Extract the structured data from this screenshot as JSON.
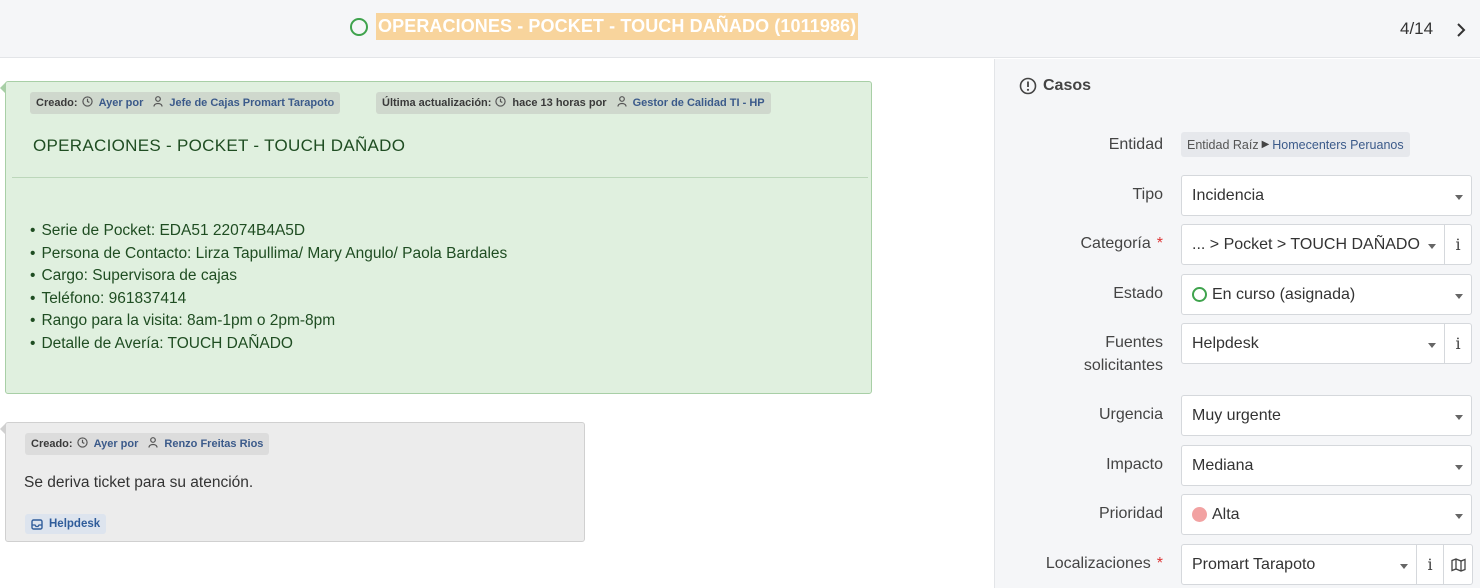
{
  "header": {
    "title": "OPERACIONES - POCKET - TOUCH DAÑADO (1011986)",
    "pager": "4/14"
  },
  "main_card": {
    "created_label": "Creado:",
    "created_when": "Ayer por",
    "created_by": "Jefe de Cajas Promart Tarapoto",
    "updated_label": "Última actualización:",
    "updated_when": "hace 13 horas por",
    "updated_by": "Gestor de Calidad TI - HP",
    "title": "OPERACIONES - POCKET - TOUCH DAÑADO",
    "details": [
      "Serie de Pocket: EDA51 22074B4A5D",
      "Persona de Contacto: Lirza Tapullima/ Mary Angulo/ Paola Bardales",
      "Cargo: Supervisora de cajas",
      "Teléfono: 961837414",
      "Rango para la visita: 8am-1pm o 2pm-8pm",
      "Detalle de Avería: TOUCH DAÑADO"
    ]
  },
  "followup": {
    "created_label": "Creado:",
    "created_when": "Ayer por",
    "created_by": "Renzo Freitas Rios",
    "text": "Se deriva ticket para su atención.",
    "source": "Helpdesk"
  },
  "panel": {
    "heading": "Casos",
    "entity": {
      "label": "Entidad",
      "root": "Entidad Raíz",
      "child": "Homecenters Peruanos"
    },
    "tipo": {
      "label": "Tipo",
      "value": "Incidencia"
    },
    "categoria": {
      "label": "Categoría",
      "value": "... > Pocket > TOUCH DAÑADO",
      "required": "*"
    },
    "estado": {
      "label": "Estado",
      "value": "En curso (asignada)"
    },
    "fuentes": {
      "label_1": "Fuentes",
      "label_2": "solicitantes",
      "value": "Helpdesk"
    },
    "urgencia": {
      "label": "Urgencia",
      "value": "Muy urgente"
    },
    "impacto": {
      "label": "Impacto",
      "value": "Mediana"
    },
    "prioridad": {
      "label": "Prioridad",
      "value": "Alta"
    },
    "localizaciones": {
      "label": "Localizaciones",
      "value": "Promart Tarapoto",
      "required": "*"
    },
    "info_glyph": "i"
  },
  "colors": {
    "status_green": "#3fa34d",
    "title_highlight": "#f8d49c",
    "card_green": "#e0f0df",
    "priority_high": "#f2a2a2"
  },
  "icons": [
    "circle-status-icon",
    "chevron-right-icon",
    "clock-icon",
    "user-icon",
    "inbox-icon",
    "alert-circle-icon",
    "info-icon",
    "map-icon"
  ]
}
